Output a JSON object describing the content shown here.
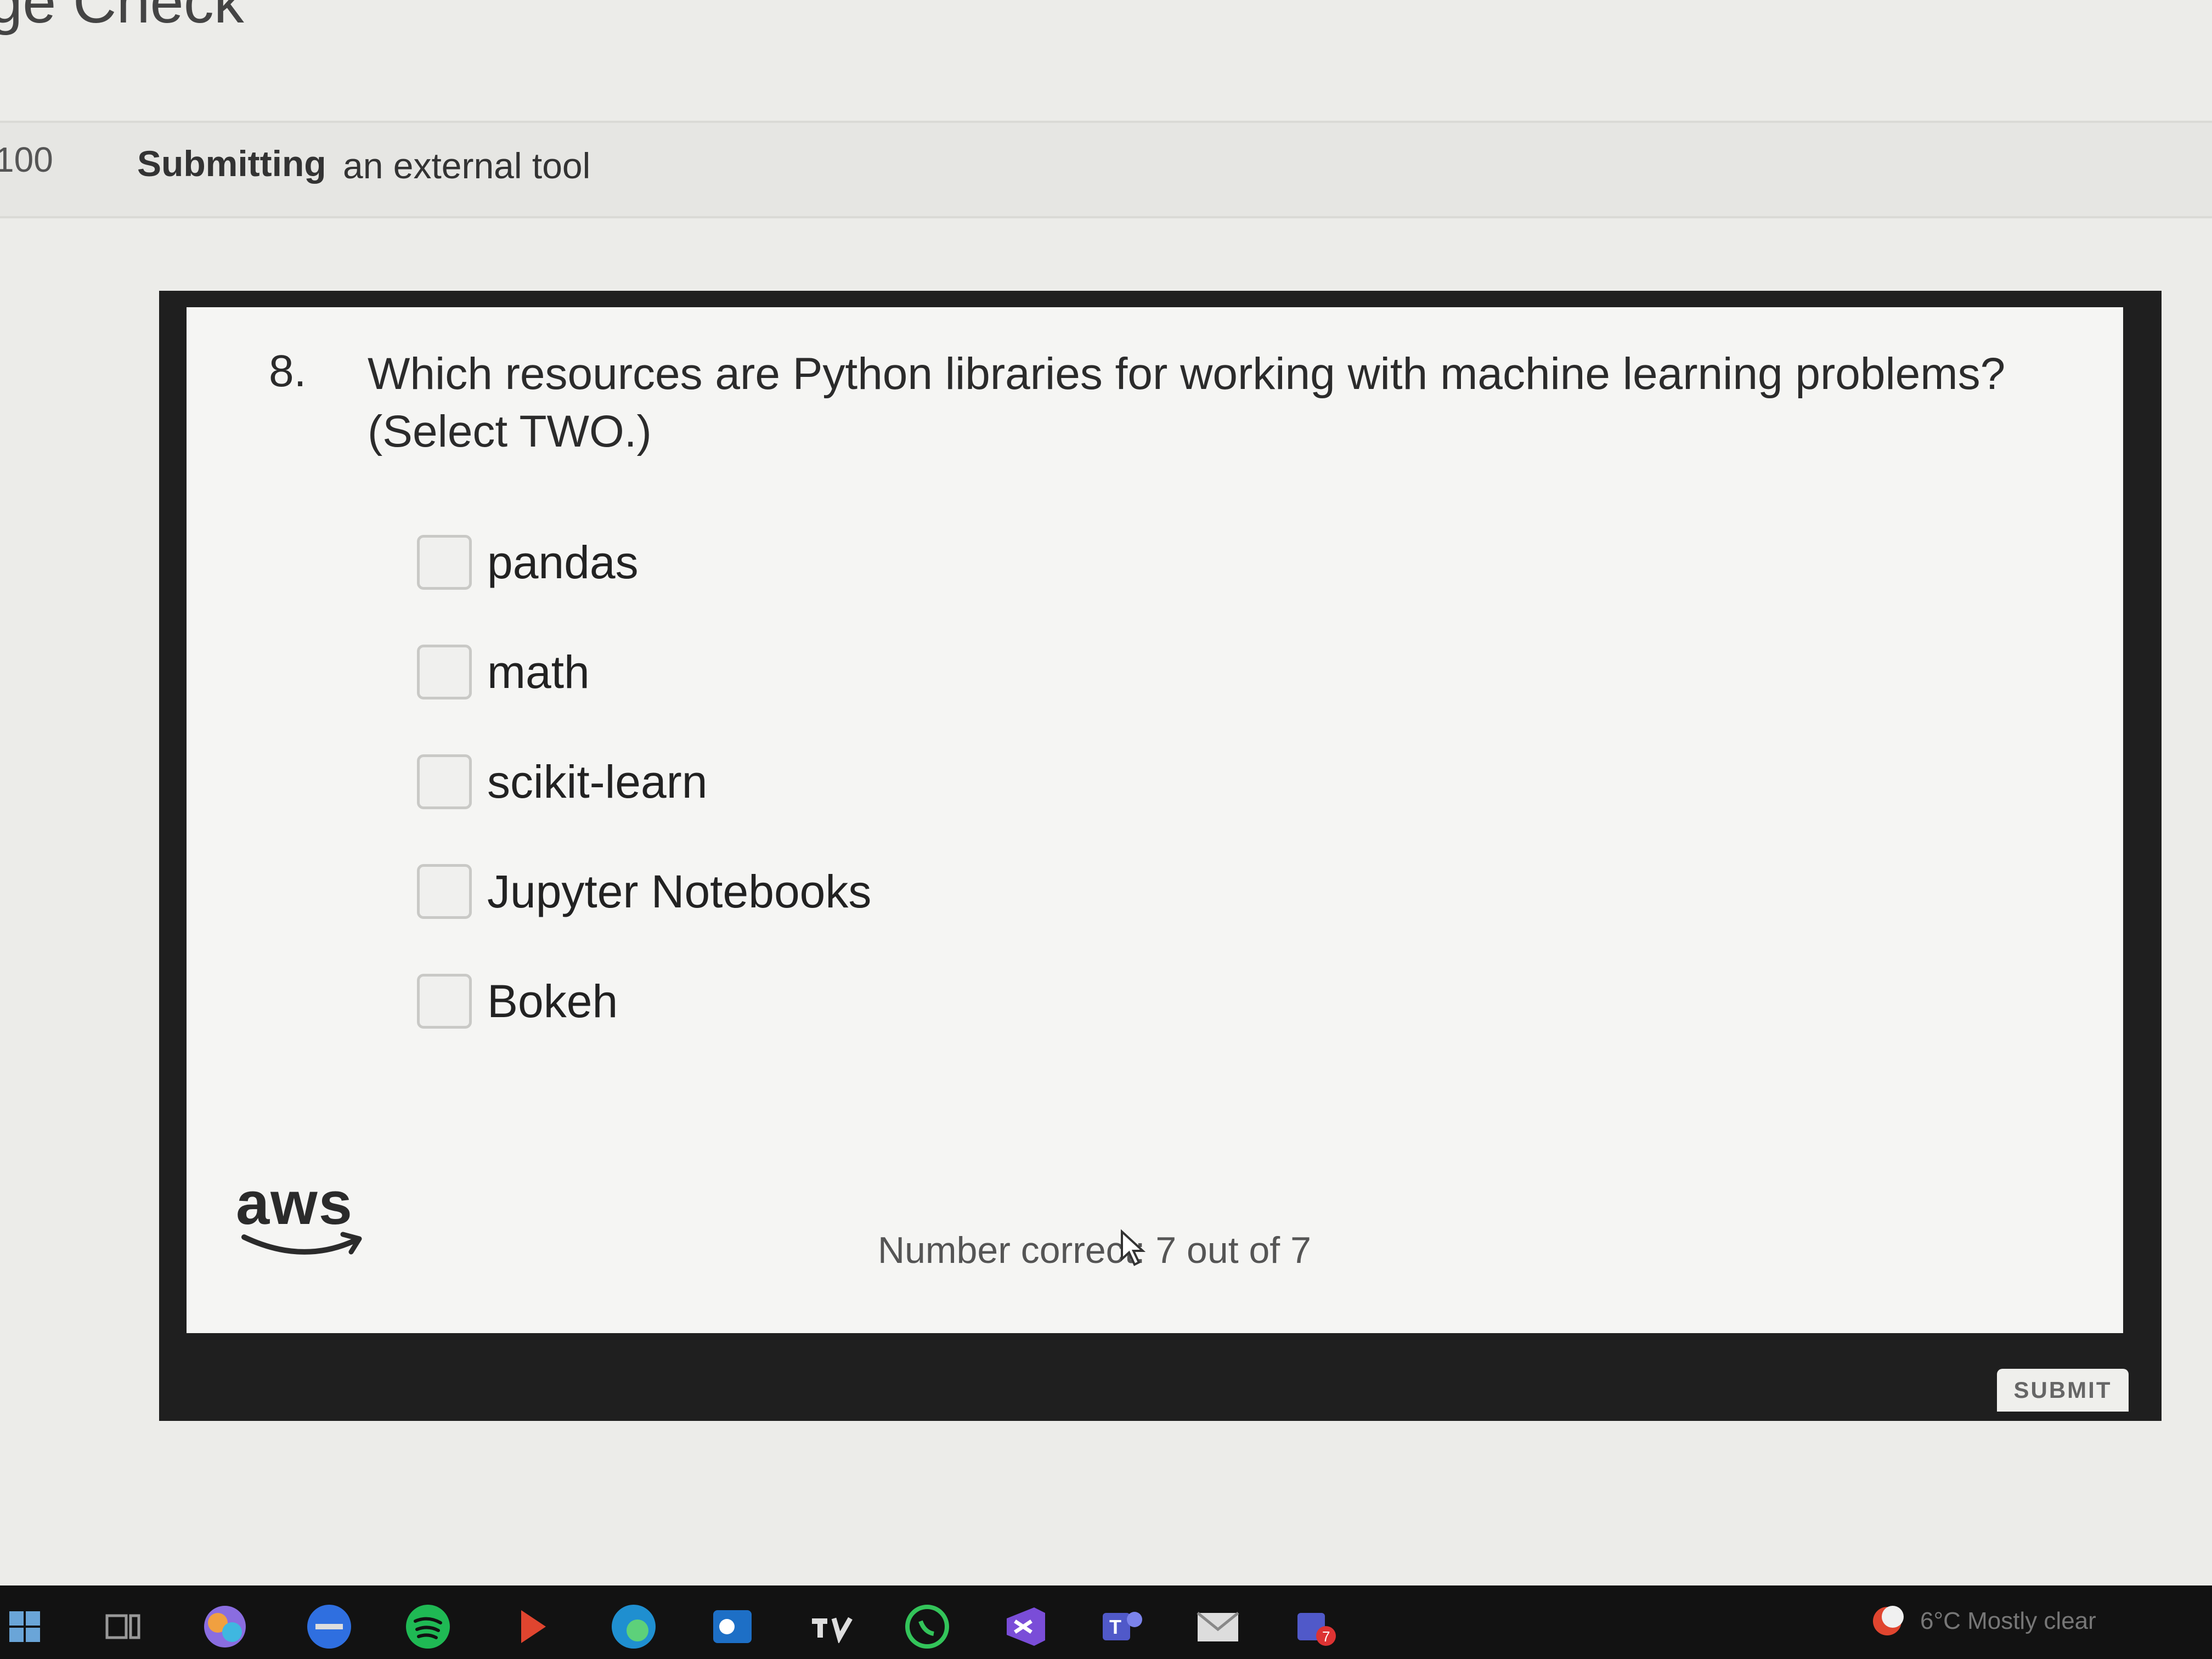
{
  "page": {
    "title": "ge Check",
    "points": "100",
    "submitting_label": "Submitting",
    "submitting_value": "an external tool"
  },
  "quiz": {
    "question_number": "8.",
    "question_text": "Which resources are Python libraries for working with machine learning problems? (Select TWO.)",
    "options": [
      {
        "label": "pandas",
        "checked": false
      },
      {
        "label": "math",
        "checked": false
      },
      {
        "label": "scikit-learn",
        "checked": false
      },
      {
        "label": "Jupyter Notebooks",
        "checked": false
      },
      {
        "label": "Bokeh",
        "checked": false
      }
    ],
    "logo_text": "aws",
    "score_text": "Number correct: 7 out of 7",
    "submit_label": "SUBMIT"
  },
  "taskbar": {
    "icons": [
      "windows-start-icon",
      "task-view-icon",
      "copilot-icon",
      "messenger-icon",
      "spotify-icon",
      "media-player-icon",
      "edge-icon",
      "outlook-icon",
      "tradingview-icon",
      "whatsapp-icon",
      "visual-studio-icon",
      "teams-icon",
      "mail-icon",
      "teams-notification-icon"
    ],
    "weather_text": "6°C Mostly clear"
  },
  "colors": {
    "frame": "#1f1f1f",
    "card": "#f5f5f3",
    "taskbar": "#121212"
  }
}
